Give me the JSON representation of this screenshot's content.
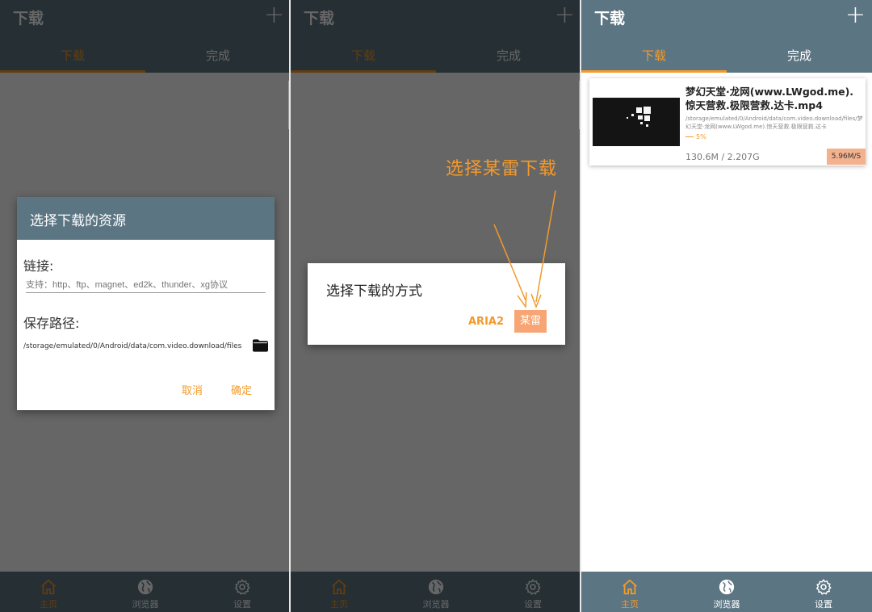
{
  "app": {
    "title": "下载",
    "add_icon": "plus-icon",
    "tabs": [
      {
        "label": "下载",
        "active": true
      },
      {
        "label": "完成",
        "active": false
      }
    ]
  },
  "bottom_nav": [
    {
      "label": "主页",
      "icon": "home-icon",
      "active": true
    },
    {
      "label": "浏览器",
      "icon": "globe-icon",
      "active": false
    },
    {
      "label": "设置",
      "icon": "gear-icon",
      "active": false
    }
  ],
  "resource_dialog": {
    "title": "选择下载的资源",
    "link_label": "链接:",
    "link_placeholder": "支持：http、ftp、magnet、ed2k、thunder、xg协议",
    "link_value": "",
    "path_label": "保存路径:",
    "path_value": "/storage/emulated/0/Android/data/com.video.download/files",
    "folder_icon": "folder-icon",
    "cancel": "取消",
    "confirm": "确定"
  },
  "method_dialog": {
    "title": "选择下载的方式",
    "option_aria2": "ARIA2",
    "option_mouse": "某雷"
  },
  "annotation": {
    "text": "选择某雷下载"
  },
  "download_item": {
    "filename": "梦幻天堂·龙网(www.LWgod.me).惊天营救.极限营救.达卡.mp4",
    "path": "/storage/emulated/0/Android/data/com.video.download/files/梦幻天堂·龙网(www.LWgod.me).惊天营救.极限营救.达卡",
    "progress_label": "5%",
    "progress": 0.05,
    "size": "130.6M / 2.207G",
    "speed": "5.96M/S"
  },
  "colors": {
    "bar": "#5c7583",
    "accent": "#f39a2b",
    "highlight": "#f7a574"
  }
}
